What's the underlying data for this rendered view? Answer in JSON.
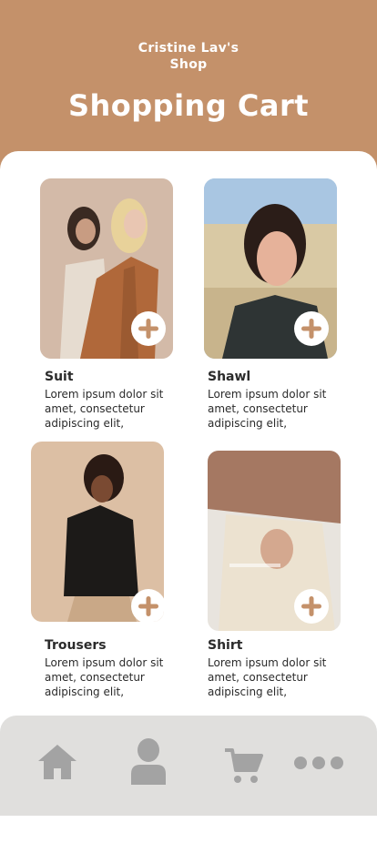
{
  "header": {
    "shop_line1": "Cristine Lav's",
    "shop_line2": "Shop",
    "title": "Shopping Cart"
  },
  "products": [
    {
      "name": "Suit",
      "desc": "Lorem ipsum dolor sit amet, consectetur adipiscing elit,"
    },
    {
      "name": "Shawl",
      "desc": "Lorem ipsum dolor sit amet, consectetur adipiscing elit,"
    },
    {
      "name": "Trousers",
      "desc": "Lorem ipsum dolor sit amet, consectetur adipiscing elit,"
    },
    {
      "name": "Shirt",
      "desc": "Lorem ipsum dolor sit amet, consectetur adipiscing elit,"
    }
  ],
  "icons": {
    "add": "plus-icon",
    "nav": [
      "home-icon",
      "user-icon",
      "cart-icon",
      "more-icon"
    ]
  },
  "colors": {
    "brand": "#c4916a",
    "plus": "#c4916a",
    "nav_bg": "#e0dfdd",
    "nav_icon": "#a3a3a3"
  }
}
